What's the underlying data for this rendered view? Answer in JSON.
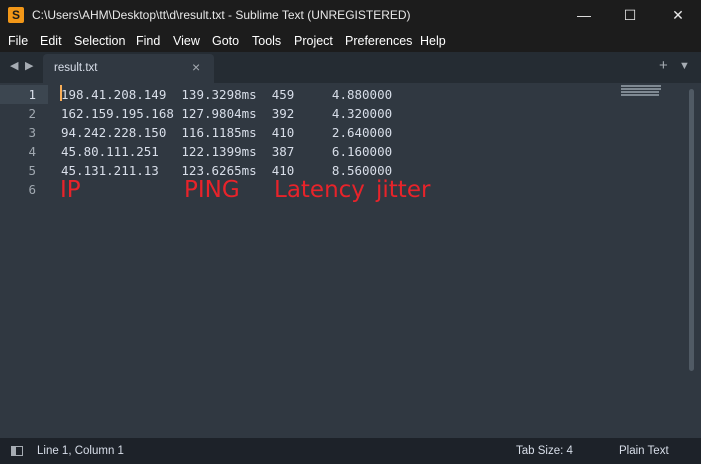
{
  "window": {
    "title": "C:\\Users\\AHM\\Desktop\\tt\\d\\result.txt - Sublime Text (UNREGISTERED)",
    "app_icon_glyph": "S",
    "minimize_glyph": "—",
    "maximize_glyph": "☐",
    "close_glyph": "✕"
  },
  "menu": {
    "items": [
      "File",
      "Edit",
      "Selection",
      "Find",
      "View",
      "Goto",
      "Tools",
      "Project",
      "Preferences",
      "Help"
    ]
  },
  "tabs": {
    "nav_prev": "◀",
    "nav_next": "▶",
    "active_tab": "result.txt",
    "close_glyph": "×",
    "new_tab": "+",
    "tab_list": "▼"
  },
  "editor": {
    "line_numbers": [
      "1",
      "2",
      "3",
      "4",
      "5",
      "6"
    ],
    "lines": [
      "198.41.208.149  139.3298ms  459     4.880000",
      "162.159.195.168 127.9804ms  392     4.320000",
      "94.242.228.150  116.1185ms  410     2.640000",
      "45.80.111.251   122.1399ms  387     6.160000",
      "45.131.211.13   123.6265ms  410     8.560000",
      ""
    ],
    "annotations": {
      "ip": "IP",
      "ping": "PING",
      "latency": "Latency",
      "jitter": "jitter"
    },
    "annotation_color": "#e8232a",
    "caret_color": "#f9ae58"
  },
  "status": {
    "position": "Line 1, Column 1",
    "tab_size": "Tab Size: 4",
    "syntax": "Plain Text"
  },
  "colors": {
    "editor_bg": "#303841",
    "titlebar_bg": "#1c1c1c",
    "statusbar_bg": "#1d2229",
    "text": "#d8dee9"
  }
}
